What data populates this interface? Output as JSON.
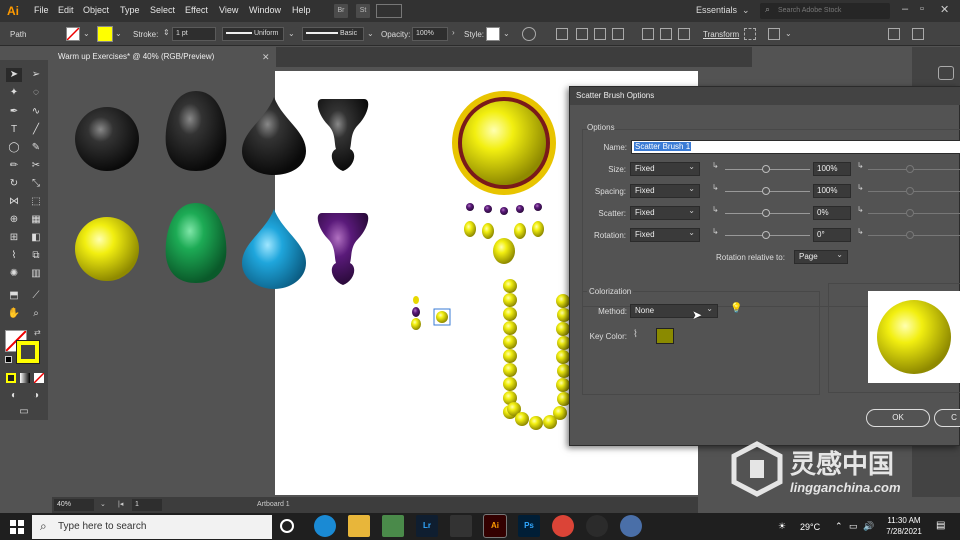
{
  "app": {
    "logo": "Ai"
  },
  "menu": [
    "File",
    "Edit",
    "Object",
    "Type",
    "Select",
    "Effect",
    "View",
    "Window",
    "Help"
  ],
  "menu_icons": {
    "bridge": "Br",
    "stock": "St"
  },
  "workspace": "Essentials",
  "stock_search_placeholder": "Search Adobe Stock",
  "control": {
    "selection": "Path",
    "stroke_label": "Stroke:",
    "stroke_value": "1 pt",
    "profile": "Uniform",
    "brush": "Basic",
    "opacity_label": "Opacity:",
    "opacity_value": "100%",
    "style_label": "Style:",
    "transform": "Transform"
  },
  "document": {
    "tab": "Warm up Exercises* @ 40% (RGB/Preview)"
  },
  "status": {
    "zoom": "40%",
    "artboard_num": "1",
    "artboard_name": "Artboard 1"
  },
  "dialog": {
    "title": "Scatter Brush Options",
    "options_label": "Options",
    "name_label": "Name:",
    "name_value": "Scatter Brush 1",
    "rows": [
      {
        "label": "Size:",
        "mode": "Fixed",
        "value": "100%"
      },
      {
        "label": "Spacing:",
        "mode": "Fixed",
        "value": "100%"
      },
      {
        "label": "Scatter:",
        "mode": "Fixed",
        "value": "0%"
      },
      {
        "label": "Rotation:",
        "mode": "Fixed",
        "value": "0°"
      }
    ],
    "rotation_relative_label": "Rotation relative to:",
    "rotation_relative_value": "Page",
    "colorization_label": "Colorization",
    "method_label": "Method:",
    "method_value": "None",
    "key_color_label": "Key Color:",
    "key_color": "#8a8a00",
    "ok": "OK",
    "cancel": "C"
  },
  "taskbar": {
    "search_placeholder": "Type here to search",
    "apps": [
      {
        "icon": "task-view-icon",
        "label": "",
        "color": "#1f1f1f"
      },
      {
        "icon": "edge-icon",
        "label": "",
        "color": "#1a8ad4"
      },
      {
        "icon": "file-explorer-icon",
        "label": "",
        "color": "#e8b63a"
      },
      {
        "icon": "app-icon",
        "label": "",
        "color": "#4a8a4a"
      },
      {
        "icon": "lightroom-icon",
        "label": "Lr",
        "color": "#0f1e30"
      },
      {
        "icon": "game-icon",
        "label": "",
        "color": "#333333"
      },
      {
        "icon": "illustrator-icon",
        "label": "Ai",
        "color": "#330000"
      },
      {
        "icon": "photoshop-icon",
        "label": "Ps",
        "color": "#001e36"
      },
      {
        "icon": "chrome-icon",
        "label": "",
        "color": "#db4437"
      },
      {
        "icon": "obs-icon",
        "label": "",
        "color": "#2b2b2b"
      },
      {
        "icon": "browser-icon",
        "label": "",
        "color": "#4a6fa8"
      }
    ],
    "temperature": "29°C",
    "time": "11:30 AM",
    "date": "7/28/2021"
  },
  "watermark": {
    "cn": "灵感中国",
    "url": "lingganchina.com"
  }
}
